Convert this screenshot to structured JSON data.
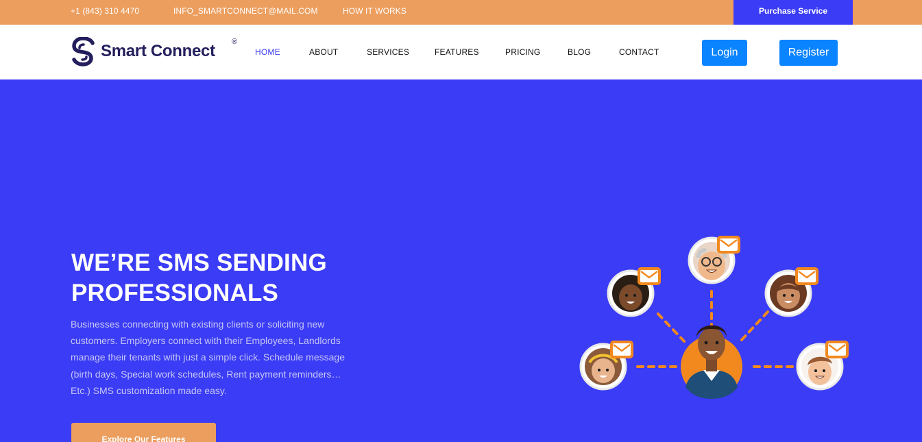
{
  "topbar": {
    "phone": "+1 (843) 310 4470",
    "email": "INFO_SMARTCONNECT@MAIL.COM",
    "how_it_works": "HOW IT WORKS",
    "purchase_label": "Purchase Service"
  },
  "brand": {
    "name": "Smart Connect",
    "registered_mark": "®"
  },
  "nav": {
    "items": [
      {
        "label": "HOME",
        "active": true
      },
      {
        "label": "ABOUT"
      },
      {
        "label": "SERVICES"
      },
      {
        "label": "FEATURES"
      },
      {
        "label": "PRICING"
      },
      {
        "label": "BLOG"
      },
      {
        "label": "CONTACT"
      }
    ],
    "login_label": "Login",
    "register_label": "Register"
  },
  "hero": {
    "title_line1": "WE’RE SMS SENDING",
    "title_line2": "PROFESSIONALS",
    "description": "Businesses connecting with existing clients or soliciting new customers. Employers connect with their Employees, Landlords manage their tenants with just a simple click. Schedule message (birth days, Special work schedules, Rent payment reminders… Etc.) SMS customization made easy.",
    "cta_label": "Explore Our Features",
    "illustration": "network-of-people-with-messages-icon"
  },
  "colors": {
    "accent_orange": "#ec9e5e",
    "primary_blue": "#3b3cf5",
    "button_blue": "#0b84ff",
    "brand_navy": "#231e5c"
  }
}
